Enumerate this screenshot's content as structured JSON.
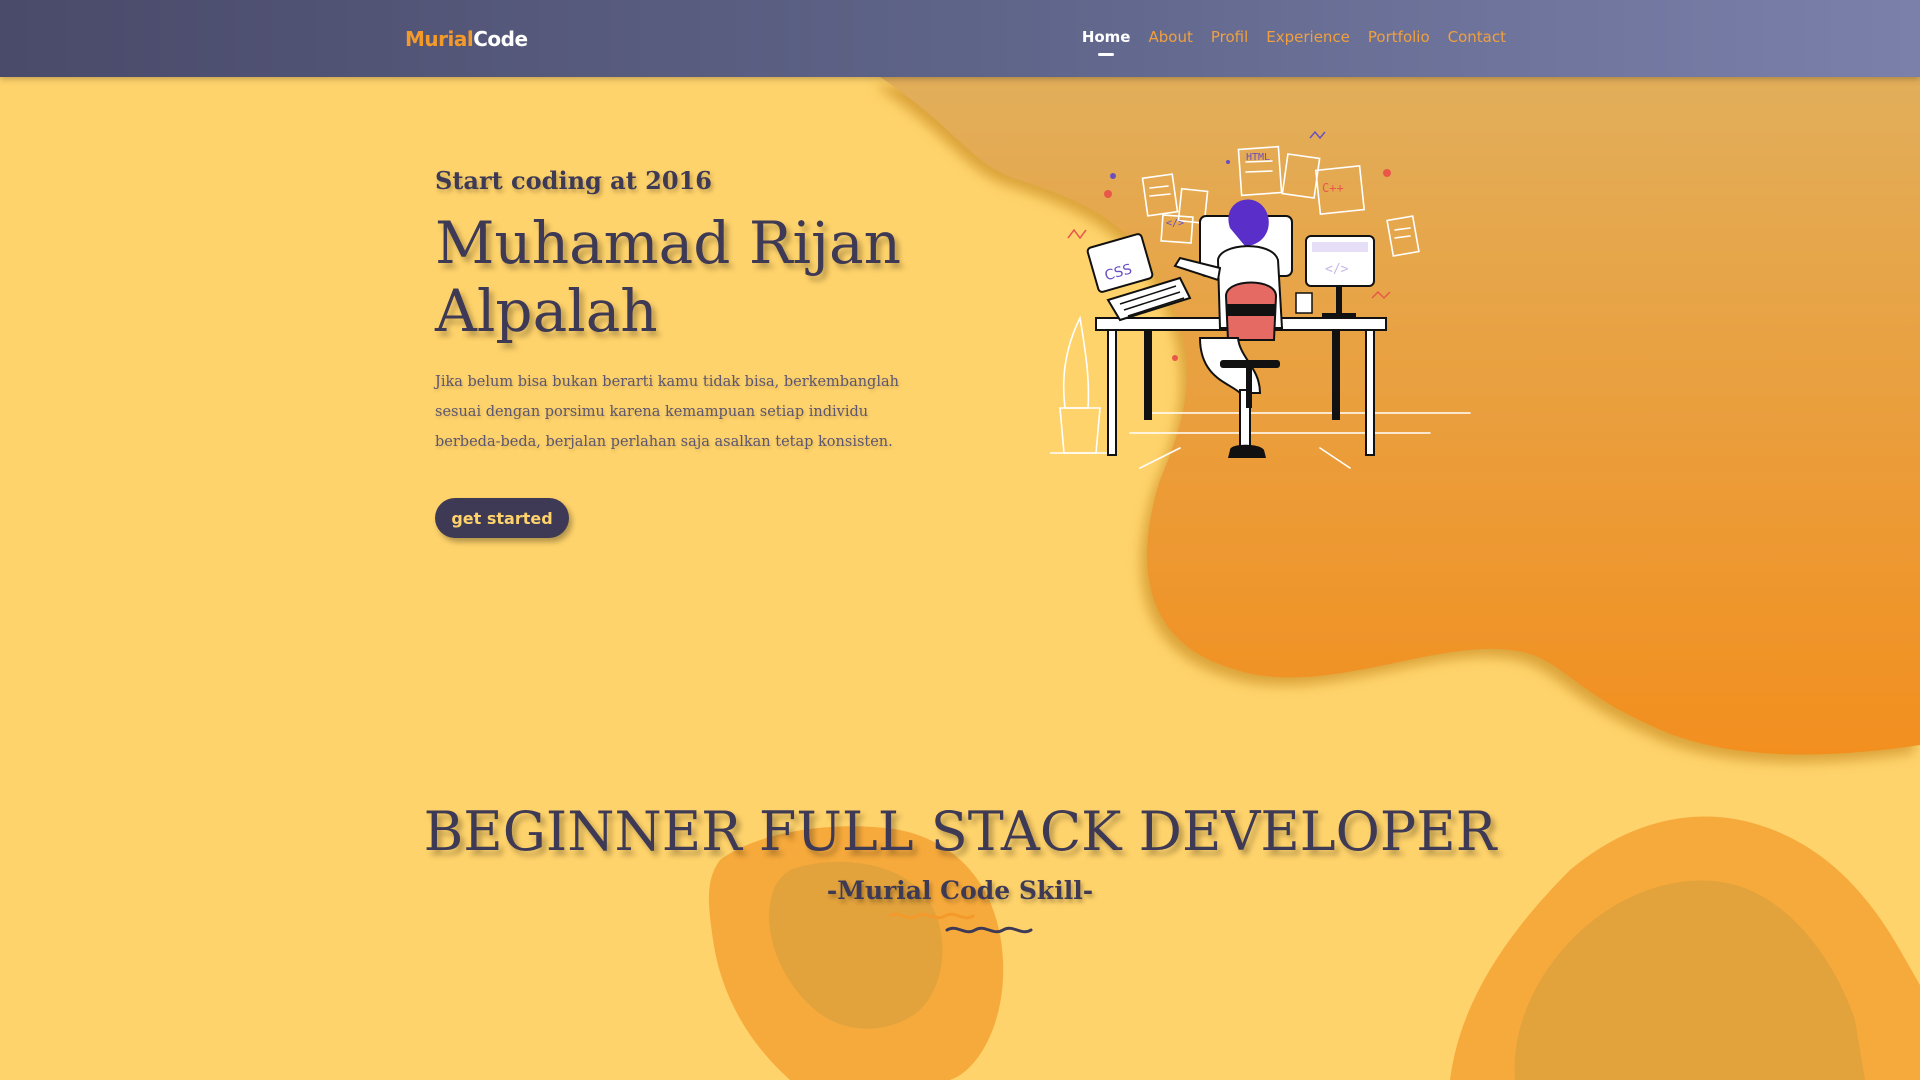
{
  "brand": {
    "part1": "Murial",
    "part2": "Code"
  },
  "nav": {
    "items": [
      {
        "label": "Home"
      },
      {
        "label": "About"
      },
      {
        "label": "Profil"
      },
      {
        "label": "Experience"
      },
      {
        "label": "Portfolio"
      },
      {
        "label": "Contact"
      }
    ],
    "active": "Home"
  },
  "hero": {
    "eyebrow": "Start coding at 2016",
    "name_line1": "Muhamad Rijan",
    "name_line2": "Alpalah",
    "description": "Jika belum bisa bukan berarti kamu tidak bisa, berkembanglah sesuai dengan porsimu karena kemampuan setiap individu berbeda-beda, berjalan perlahan saja asalkan tetap konsisten.",
    "cta": "get started"
  },
  "illustration": {
    "laptop_label": "CSS",
    "paper_label_1": "HTML",
    "paper_label_2": "C++",
    "code_tag": "</>"
  },
  "section": {
    "title": "BEGINNER FULL STACK DEVELOPER",
    "subtitle": "-Murial Code Skill-"
  },
  "colors": {
    "background": "#ffd36b",
    "accent": "#f39a2b",
    "dark": "#3e3a55",
    "navbar_from": "#4a4a6a",
    "navbar_to": "#7a80aa"
  }
}
